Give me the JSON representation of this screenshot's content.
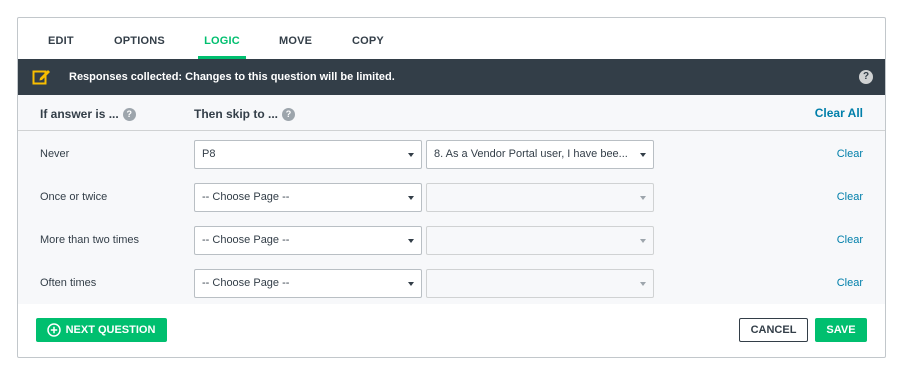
{
  "tabs": [
    {
      "label": "EDIT",
      "active": false
    },
    {
      "label": "OPTIONS",
      "active": false
    },
    {
      "label": "LOGIC",
      "active": true
    },
    {
      "label": "MOVE",
      "active": false
    },
    {
      "label": "COPY",
      "active": false
    }
  ],
  "banner": {
    "text": "Responses collected: Changes to this question will be limited.",
    "help_glyph": "?"
  },
  "logic": {
    "if_answer_label": "If answer is ...",
    "then_skip_label": "Then skip to ...",
    "help_glyph": "?",
    "clear_all_label": "Clear All",
    "rules": [
      {
        "answer": "Never",
        "page": "P8",
        "question": "8. As a Vendor Portal user, I have bee...",
        "question_enabled": true,
        "clear_label": "Clear"
      },
      {
        "answer": "Once or twice",
        "page": "-- Choose Page --",
        "question": "",
        "question_enabled": false,
        "clear_label": "Clear"
      },
      {
        "answer": "More than two times",
        "page": "-- Choose Page --",
        "question": "",
        "question_enabled": false,
        "clear_label": "Clear"
      },
      {
        "answer": "Often times",
        "page": "-- Choose Page --",
        "question": "",
        "question_enabled": false,
        "clear_label": "Clear"
      }
    ]
  },
  "footer": {
    "next_question_label": "NEXT QUESTION",
    "cancel_label": "CANCEL",
    "save_label": "SAVE"
  },
  "colors": {
    "accent_green": "#00bf6f",
    "banner_bg": "#333e48",
    "link_blue": "#007faa",
    "warning_icon": "#f9be00"
  },
  "icons": {
    "banner_left": "edit-warning-icon",
    "banner_right": "help-icon",
    "next_question": "plus-circle-icon",
    "select": "caret-down-icon"
  }
}
